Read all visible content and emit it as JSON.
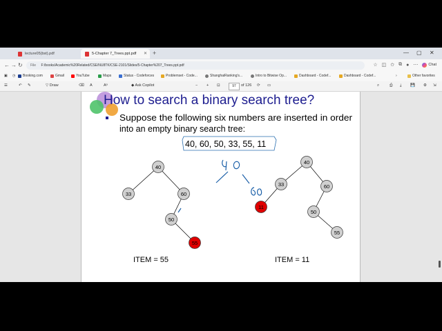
{
  "tabs": [
    {
      "label": "lecture05(bst).pdf",
      "active": false
    },
    {
      "label": "5-Chapter 7_Trees.ppt.pdf",
      "active": true
    }
  ],
  "address": {
    "file_label": "File",
    "url": "F:/books/Academic%20Related/CSE/NU8TK/CSE-2101/Slides/5-Chapter%207_Trees.ppt.pdf",
    "chat": "Chat"
  },
  "bookmarks": [
    "Booking.com",
    "Gmail",
    "YouTube",
    "Maps",
    "Status - Codeforces",
    "Problemset - Code...",
    "ShanghaiRanking's...",
    "Intro to Bitwise Op...",
    "Dashboard - Codef...",
    "Dashboard - Codef...",
    "Other favorites"
  ],
  "pdf_toolbar": {
    "draw": "Draw",
    "copilot": "Ask Copilot",
    "page": "97",
    "total": "of 126"
  },
  "slide": {
    "title": "How to search a binary search tree?",
    "body": "Suppose the following six numbers are inserted in order into an empty binary search tree:",
    "sequence": "40, 60, 50, 33, 55, 11",
    "handwritten": [
      "40",
      "60"
    ],
    "left_tree": {
      "nodes": [
        "40",
        "33",
        "60",
        "50",
        "55"
      ],
      "caption": "ITEM = 55"
    },
    "right_tree": {
      "nodes": [
        "40",
        "33",
        "60",
        "11",
        "50",
        "55"
      ],
      "caption": "ITEM = 11"
    }
  },
  "colors": {
    "title": "#1d1d8f",
    "node": "#d0d0d0",
    "highlight": "#e00000",
    "ink": "#1a5fa8"
  }
}
